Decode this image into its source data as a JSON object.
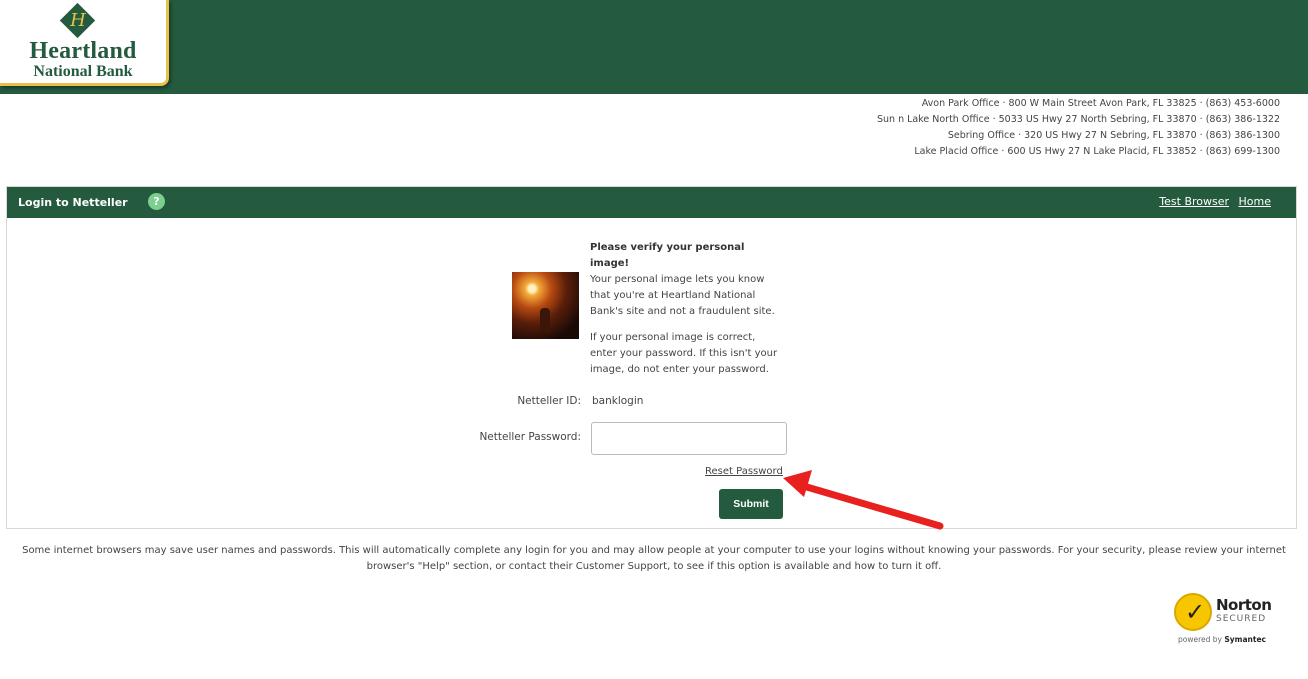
{
  "header": {
    "logo_monogram": "H",
    "logo_line1": "Heartland",
    "logo_line2": "National Bank"
  },
  "offices": [
    "Avon Park Office · 800 W Main Street Avon Park, FL 33825 · (863) 453-6000",
    "Sun n Lake North Office · 5033 US Hwy 27 North Sebring, FL 33870 · (863) 386-1322",
    "Sebring Office · 320 US Hwy 27 N Sebring, FL 33870 · (863) 386-1300",
    "Lake Placid Office · 600 US Hwy 27 N Lake Placid, FL 33852 · (863) 699-1300"
  ],
  "panel": {
    "title": "Login to Netteller",
    "help_glyph": "?",
    "links": {
      "test_browser": "Test Browser",
      "home": "Home"
    }
  },
  "verify": {
    "heading": "Please verify your personal image!",
    "para1": "Your personal image lets you know that you're at Heartland National Bank's site and not a fraudulent site.",
    "para2": "If your personal image is correct, enter your password. If this isn't your image, do not enter your password."
  },
  "form": {
    "id_label": "Netteller ID:",
    "id_value": "banklogin",
    "password_label": "Netteller Password:",
    "password_value": "",
    "reset_link": "Reset Password",
    "submit_label": "Submit"
  },
  "disclaimer": "Some internet browsers may save user names and passwords. This will automatically complete any login for you and may allow people at your computer to use your logins without knowing your passwords. For your security, please review your internet browser's \"Help\" section, or contact their Customer Support, to see if this option is available and how to turn it off.",
  "norton": {
    "check_glyph": "✓",
    "name": "Norton",
    "secured": "SECURED",
    "powered_by": "powered by",
    "vendor": "Symantec"
  },
  "colors": {
    "brand_green": "#245a3e",
    "logo_gold": "#e6c24a",
    "annotation_red": "#e8211f"
  }
}
